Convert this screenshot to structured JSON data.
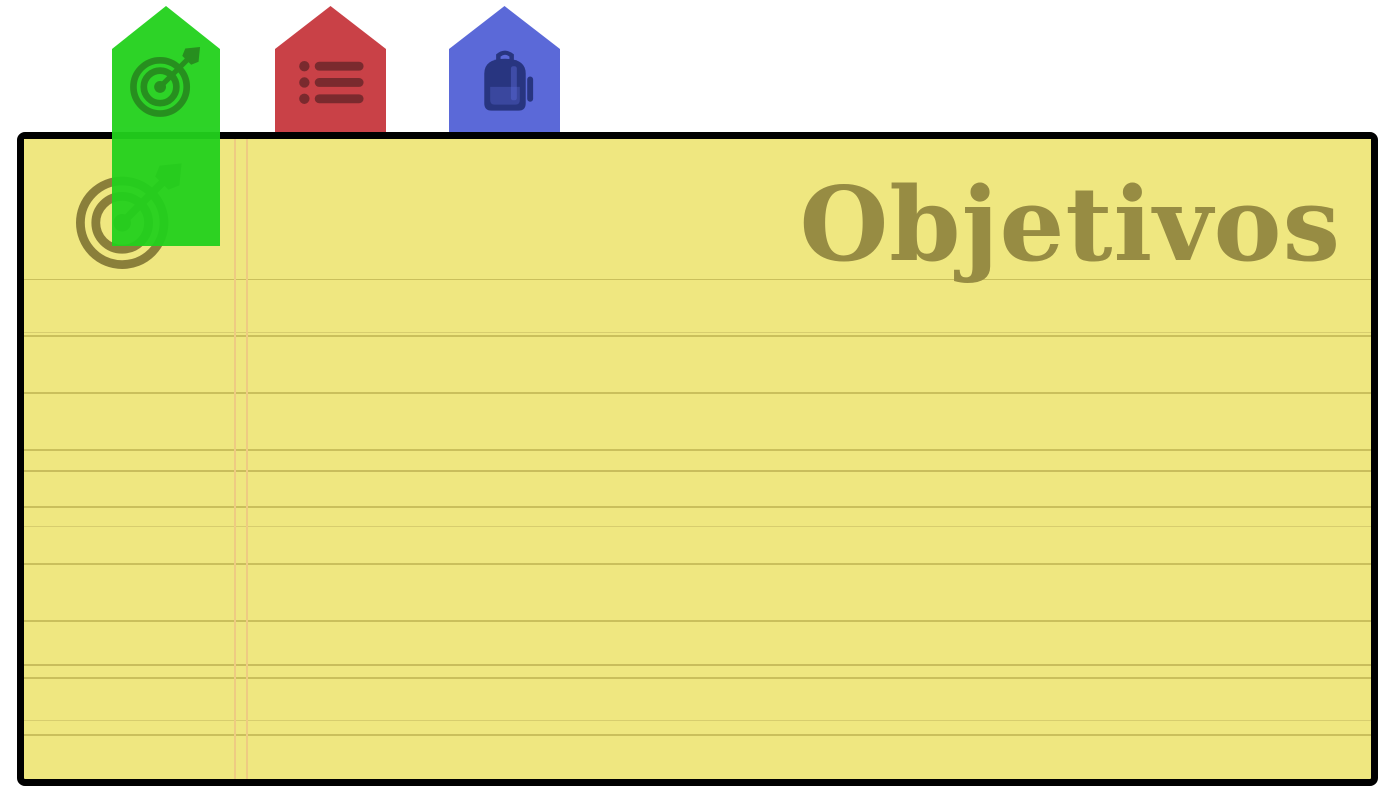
{
  "page": {
    "title": "Objetivos"
  },
  "tabs": [
    {
      "id": "objetivos",
      "icon": "target-arrow-icon",
      "color": "#22d11c",
      "icon_color": "#1c8a14",
      "active": true
    },
    {
      "id": "lista",
      "icon": "list-icon",
      "color": "#c94147",
      "icon_color": "#7a2a2e",
      "active": false
    },
    {
      "id": "mochila",
      "icon": "backpack-icon",
      "color": "#5b69d8",
      "icon_color": "#283580",
      "active": false
    }
  ],
  "colors": {
    "paper": "#efe780",
    "rule": "#c9bd5c",
    "margin": "#eecb82",
    "title": "#978c43",
    "border": "#000000"
  }
}
